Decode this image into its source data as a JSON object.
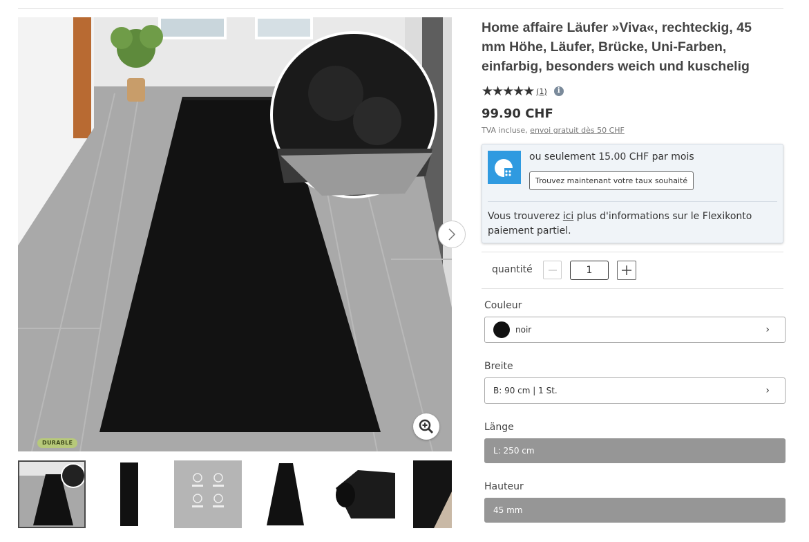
{
  "product": {
    "title": "Home affaire Läufer »Viva«, rechteckig, 45 mm Höhe, Läufer, Brücke, Uni-Farben, einfarbig, besonders weich und kuschelig",
    "rating_stars": "★★★★★",
    "rating_count": "(1)",
    "price": "99.90 CHF",
    "vat_text": "TVA incluse, ",
    "shipping_link": "envoi gratuit dès 50 CHF",
    "badge": "DURABLE"
  },
  "flexikonto": {
    "monthly_text": "ou seulement 15.00 CHF par mois",
    "button_label": "Trouvez maintenant votre taux souhaité",
    "more_before": "Vous trouverez ",
    "more_link": "ici",
    "more_after": " plus d'informations sur le Flexikonto paiement partiel."
  },
  "quantity": {
    "label": "quantité",
    "value": "1"
  },
  "options": {
    "color": {
      "label": "Couleur",
      "value": "noir",
      "swatch": "#111111"
    },
    "width": {
      "label": "Breite",
      "value": "B: 90 cm | 1 St."
    },
    "length": {
      "label": "Länge",
      "value": "L: 250 cm"
    },
    "height": {
      "label": "Hauteur",
      "value": "45 mm"
    }
  },
  "icons": {
    "next": "chevron-right-icon",
    "zoom": "zoom-in-icon",
    "info": "info-icon",
    "minus": "minus-icon",
    "plus": "plus-icon"
  }
}
